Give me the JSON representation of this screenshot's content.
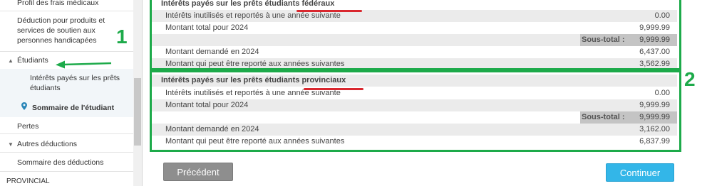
{
  "sidebar": {
    "items": [
      {
        "label": "Profil des frais médicaux"
      },
      {
        "label": "Déduction pour produits et services de soutien aux personnes handicapées"
      },
      {
        "label": "Étudiants",
        "caret": "▲"
      },
      {
        "label": "Intérêts payés sur les prêts étudiants"
      },
      {
        "label": "Sommaire de l'étudiant"
      },
      {
        "label": "Pertes"
      },
      {
        "label": "Autres déductions",
        "caret": "▼"
      },
      {
        "label": "Sommaire des déductions"
      },
      {
        "label": "PROVINCIAL"
      }
    ]
  },
  "federal": {
    "title": "Intérêts payés sur les prêts étudiants fédéraux",
    "rows": [
      {
        "label": "Intérêts inutilisés et reportés à une année suivante",
        "value": "0.00"
      },
      {
        "label": "Montant total pour 2024",
        "value": "9,999.99"
      },
      {
        "subtotal_label": "Sous-total :",
        "value": "9,999.99"
      },
      {
        "label": "Montant demandé en 2024",
        "value": "6,437.00"
      },
      {
        "label": "Montant qui peut être reporté aux années suivantes",
        "value": "3,562.99"
      }
    ]
  },
  "provincial": {
    "title": "Intérêts payés sur les prêts étudiants provinciaux",
    "rows": [
      {
        "label": "Intérêts inutilisés et reportés à une année suivante",
        "value": "0.00"
      },
      {
        "label": "Montant total pour 2024",
        "value": "9,999.99"
      },
      {
        "subtotal_label": "Sous-total :",
        "value": "9,999.99"
      },
      {
        "label": "Montant demandé en 2024",
        "value": "3,162.00"
      },
      {
        "label": "Montant qui peut être reporté aux années suivantes",
        "value": "6,837.99"
      }
    ]
  },
  "annotations": {
    "one": "1",
    "two": "2"
  },
  "buttons": {
    "previous": "Précédent",
    "continue": "Continuer"
  },
  "colors": {
    "annotation_green": "#1daa4a",
    "underline_red": "#d9272e",
    "continue_blue": "#33b6e8"
  }
}
